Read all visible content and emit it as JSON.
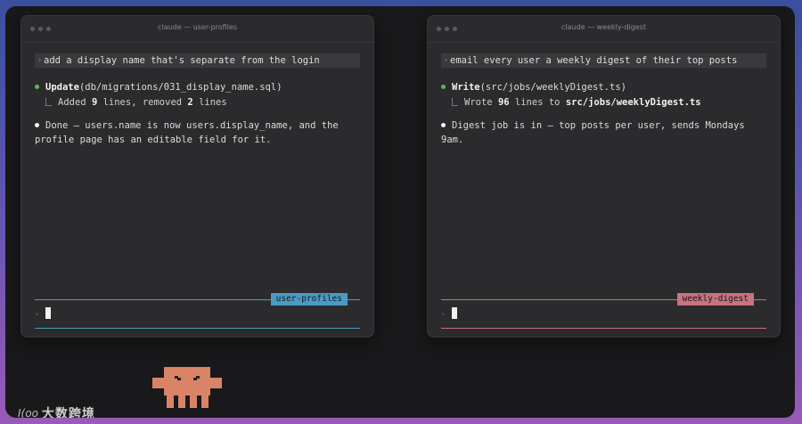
{
  "accent_left": "#4a9bc4",
  "accent_right": "#c8737f",
  "windows": [
    {
      "title": "claude — user-profiles",
      "prompt": "add a display name that's separate from the login",
      "tool_name": "Update",
      "tool_arg": "(db/migrations/031_display_name.sql)",
      "result": {
        "pre": "Added ",
        "n1": "9",
        "mid": " lines, removed ",
        "n2": "2",
        "post": " lines"
      },
      "message": "Done — users.name is now users.display_name, and the profile page has an editable field for it.",
      "tag": "user-profiles"
    },
    {
      "title": "claude — weekly-digest",
      "prompt": "email every user a weekly digest of their top posts",
      "tool_name": "Write",
      "tool_arg": "(src/jobs/weeklyDigest.ts)",
      "result": {
        "pre": "Wrote ",
        "n1": "96",
        "mid": " lines to ",
        "n2": "src/jobs/weeklyDigest.ts",
        "post": ""
      },
      "message": "Digest job is in — top posts per user, sends Mondays 9am.",
      "tag": "weekly-digest"
    }
  ],
  "prompt_glyph": "›",
  "watermark": {
    "logo": "I(oo",
    "text": "大数跨境"
  }
}
